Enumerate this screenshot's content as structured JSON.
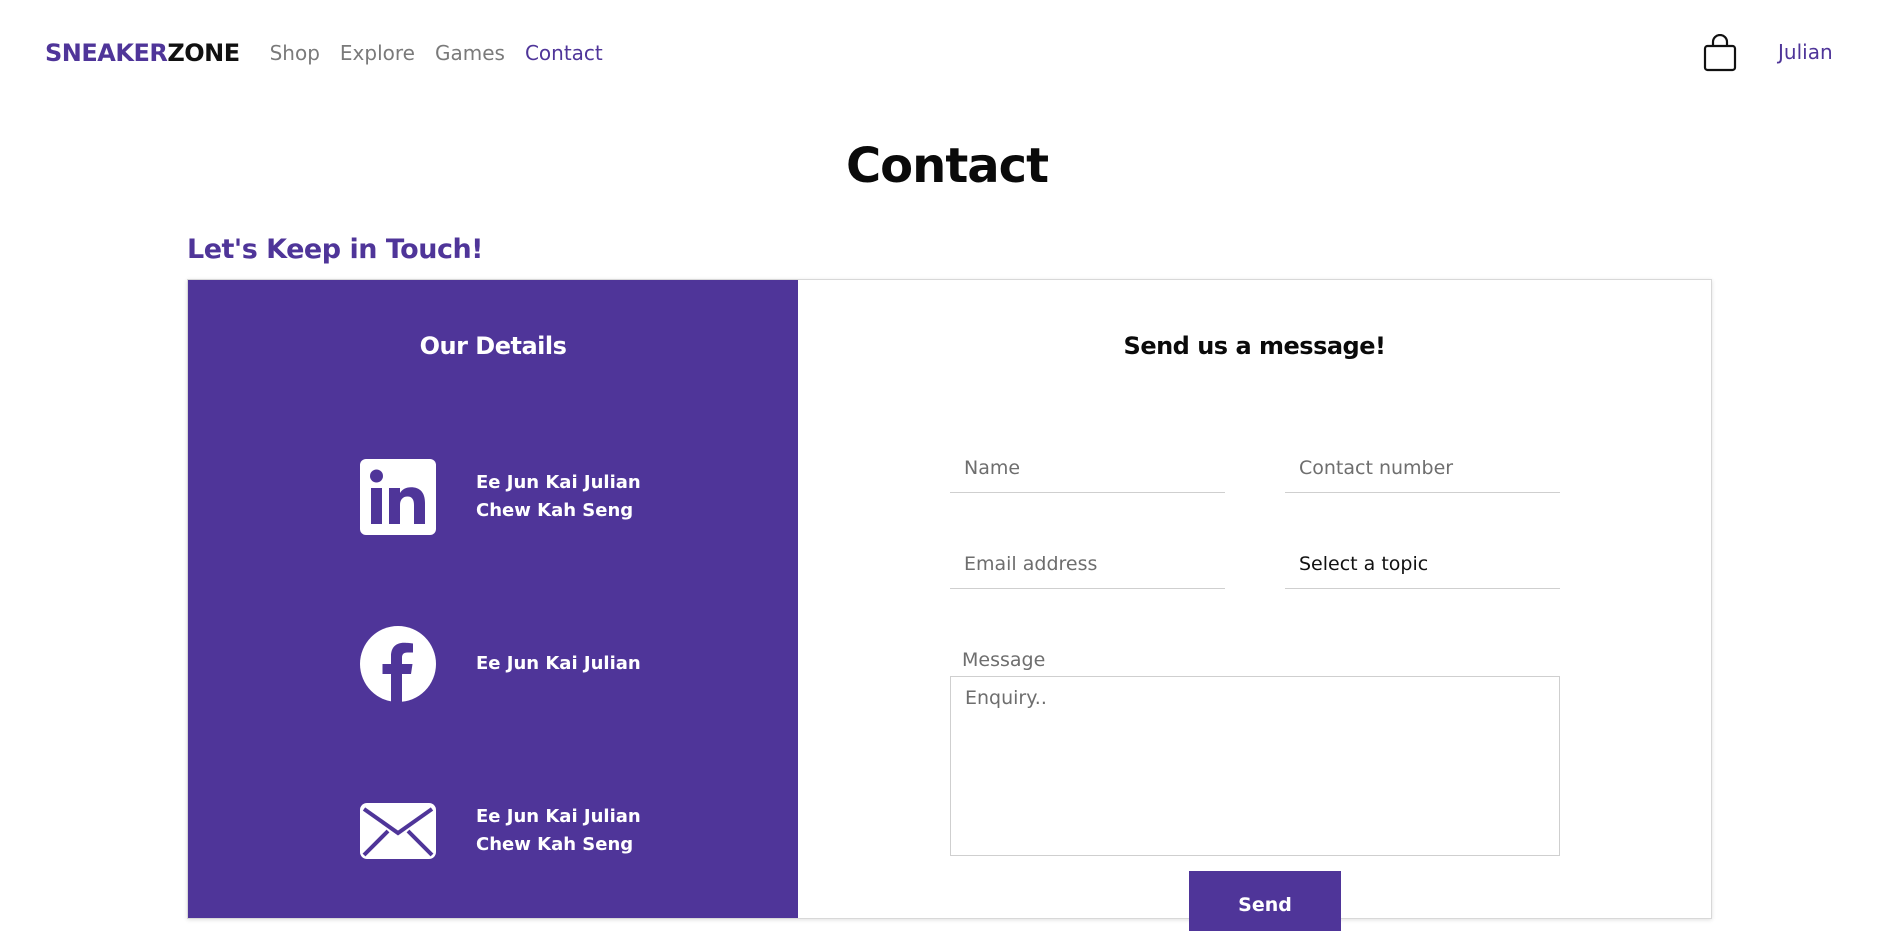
{
  "navbar": {
    "brand_part1": "SNEAKER",
    "brand_part2": "ZONE",
    "links": [
      "Shop",
      "Explore",
      "Games",
      "Contact"
    ],
    "active_link": "Contact",
    "user_name": "Julian"
  },
  "page": {
    "title": "Contact",
    "subtitle": "Let's Keep in Touch!"
  },
  "details": {
    "title": "Our Details",
    "items": [
      {
        "icon": "linkedin-icon",
        "lines": [
          "Ee Jun Kai Julian",
          "Chew Kah Seng"
        ]
      },
      {
        "icon": "facebook-icon",
        "lines": [
          "Ee Jun Kai Julian"
        ]
      },
      {
        "icon": "email-icon",
        "lines": [
          "Ee Jun Kai Julian",
          "Chew Kah Seng"
        ]
      }
    ]
  },
  "form": {
    "title": "Send us a message!",
    "name_placeholder": "Name",
    "contact_placeholder": "Contact number",
    "email_placeholder": "Email address",
    "topic_selected": "Select a topic",
    "message_label": "Message",
    "message_placeholder": "Enquiry..",
    "send_label": "Send"
  },
  "colors": {
    "accent": "#4f3599",
    "text": "#111111",
    "muted": "#7a7a7a"
  }
}
